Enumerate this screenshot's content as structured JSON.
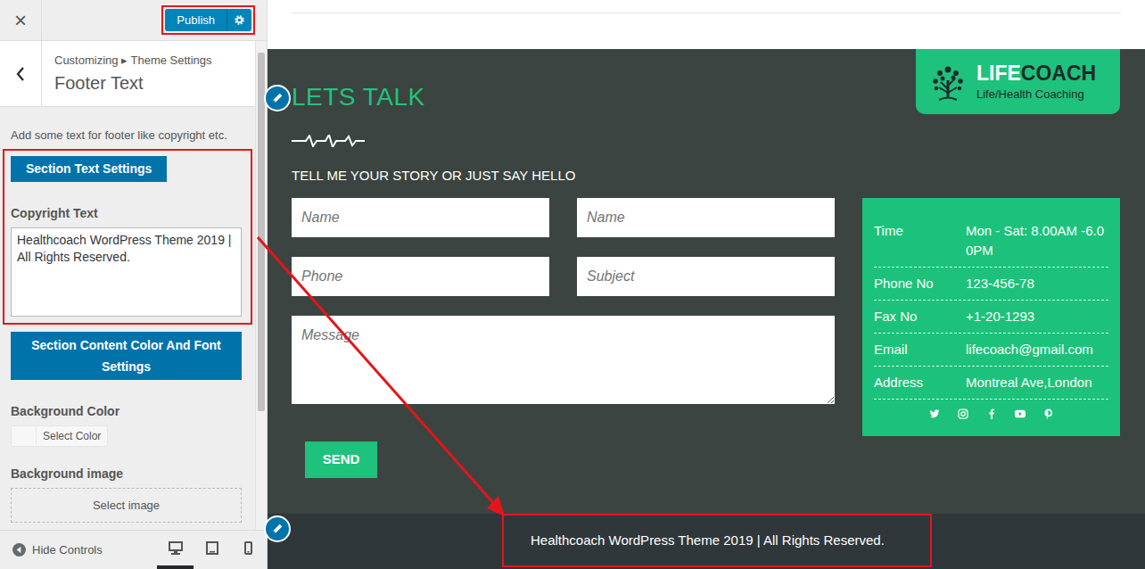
{
  "customizer": {
    "close": "×",
    "publish": {
      "label": "Publish",
      "highlighted": true
    },
    "breadcrumb": "Customizing ▸ Theme Settings",
    "title": "Footer Text",
    "description": "Add some text for footer like copyright etc.",
    "groups": [
      {
        "highlighted": true,
        "controls": [
          {
            "kind": "section",
            "label": "Section Text Settings"
          },
          {
            "kind": "textarea",
            "label": "Copyright Text",
            "value": "Healthcoach WordPress Theme 2019 | All Rights Reserved."
          }
        ]
      },
      {
        "highlighted": false,
        "controls": [
          {
            "kind": "section",
            "label": "Section Content Color And Font Settings"
          },
          {
            "kind": "color",
            "label": "Background Color",
            "button": "Select Color"
          },
          {
            "kind": "image",
            "label": "Background image",
            "button": "Select image"
          }
        ]
      }
    ],
    "hide_controls": "Hide Controls",
    "devices": [
      {
        "kind": "desktop",
        "selected": true
      },
      {
        "kind": "tablet",
        "selected": false
      },
      {
        "kind": "mobile",
        "selected": false
      }
    ]
  },
  "preview": {
    "logo": {
      "first": "LIFE",
      "second": "COACH",
      "tagline": "Life/Health Coaching"
    },
    "contact": {
      "title": "LETS TALK",
      "subtitle": "TELL ME YOUR STORY OR JUST SAY HELLO",
      "fields": [
        {
          "kind": "input",
          "placeholder": "Name"
        },
        {
          "kind": "input",
          "placeholder": "Name"
        },
        {
          "kind": "input",
          "placeholder": "Phone"
        },
        {
          "kind": "input",
          "placeholder": "Subject"
        },
        {
          "kind": "textarea",
          "placeholder": "Message"
        }
      ],
      "send": "SEND"
    },
    "info": {
      "rows": [
        {
          "label": "Time",
          "value": "Mon - Sat: 8.00AM -6.00PM"
        },
        {
          "label": "Phone No",
          "value": "123-456-78"
        },
        {
          "label": "Fax No",
          "value": "+1-20-1293"
        },
        {
          "label": "Email",
          "value": "lifecoach@gmail.com"
        },
        {
          "label": "Address",
          "value": "Montreal Ave,London"
        }
      ],
      "social": [
        {
          "kind": "twitter"
        },
        {
          "kind": "instagram"
        },
        {
          "kind": "facebook"
        },
        {
          "kind": "youtube"
        },
        {
          "kind": "pinterest"
        }
      ]
    },
    "footer": {
      "text": "Healthcoach WordPress Theme 2019 | All Rights Reserved.",
      "highlighted": true
    }
  }
}
